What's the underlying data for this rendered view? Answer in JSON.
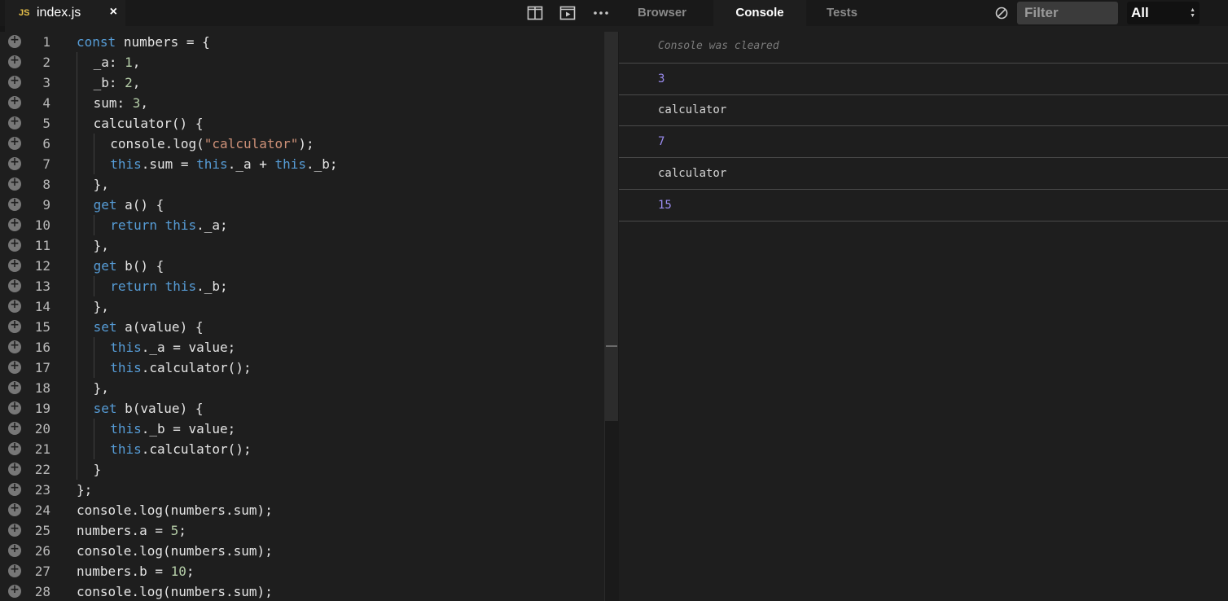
{
  "file_tab": {
    "badge": "JS",
    "name": "index.js",
    "close": "×"
  },
  "panel_tabs": [
    "Browser",
    "Console",
    "Tests"
  ],
  "active_panel": "Console",
  "console_toolbar": {
    "filter_placeholder": "Filter",
    "level": "All"
  },
  "toolbar_icons": [
    "split-editor-icon",
    "preview-icon",
    "more-icon",
    "clear-console-icon"
  ],
  "code_lines": [
    {
      "n": "1",
      "indent": 0,
      "tokens": [
        [
          "kw",
          "const"
        ],
        [
          "",
          "numbers = {"
        ]
      ]
    },
    {
      "n": "2",
      "indent": 1,
      "tokens": [
        [
          "",
          "_a: "
        ],
        [
          "num",
          "1"
        ],
        [
          "",
          ","
        ]
      ]
    },
    {
      "n": "3",
      "indent": 1,
      "tokens": [
        [
          "",
          "_b: "
        ],
        [
          "num",
          "2"
        ],
        [
          "",
          ","
        ]
      ]
    },
    {
      "n": "4",
      "indent": 1,
      "tokens": [
        [
          "",
          "sum: "
        ],
        [
          "num",
          "3"
        ],
        [
          "",
          ","
        ]
      ]
    },
    {
      "n": "5",
      "indent": 1,
      "tokens": [
        [
          "",
          "calculator() {"
        ]
      ]
    },
    {
      "n": "6",
      "indent": 2,
      "tokens": [
        [
          "",
          "console.log("
        ],
        [
          "str",
          "\"calculator\""
        ],
        [
          "",
          ");"
        ]
      ]
    },
    {
      "n": "7",
      "indent": 2,
      "tokens": [
        [
          "kw",
          "this"
        ],
        [
          "",
          ".sum = "
        ],
        [
          "kw",
          "this"
        ],
        [
          "",
          "._a + "
        ],
        [
          "kw",
          "this"
        ],
        [
          "",
          "._b;"
        ]
      ]
    },
    {
      "n": "8",
      "indent": 1,
      "tokens": [
        [
          "",
          "},"
        ]
      ]
    },
    {
      "n": "9",
      "indent": 1,
      "tokens": [
        [
          "kw",
          "get"
        ],
        [
          "",
          " a() {"
        ]
      ]
    },
    {
      "n": "10",
      "indent": 2,
      "tokens": [
        [
          "kw",
          "return"
        ],
        [
          "",
          " "
        ],
        [
          "kw",
          "this"
        ],
        [
          "",
          "._a;"
        ]
      ]
    },
    {
      "n": "11",
      "indent": 1,
      "tokens": [
        [
          "",
          "},"
        ]
      ]
    },
    {
      "n": "12",
      "indent": 1,
      "tokens": [
        [
          "kw",
          "get"
        ],
        [
          "",
          " b() {"
        ]
      ]
    },
    {
      "n": "13",
      "indent": 2,
      "tokens": [
        [
          "kw",
          "return"
        ],
        [
          "",
          " "
        ],
        [
          "kw",
          "this"
        ],
        [
          "",
          "._b;"
        ]
      ]
    },
    {
      "n": "14",
      "indent": 1,
      "tokens": [
        [
          "",
          "},"
        ]
      ]
    },
    {
      "n": "15",
      "indent": 1,
      "tokens": [
        [
          "kw",
          "set"
        ],
        [
          "",
          " a(value) {"
        ]
      ]
    },
    {
      "n": "16",
      "indent": 2,
      "tokens": [
        [
          "kw",
          "this"
        ],
        [
          "",
          "._a = value;"
        ]
      ]
    },
    {
      "n": "17",
      "indent": 2,
      "tokens": [
        [
          "kw",
          "this"
        ],
        [
          "",
          ".calculator();"
        ]
      ]
    },
    {
      "n": "18",
      "indent": 1,
      "tokens": [
        [
          "",
          "},"
        ]
      ]
    },
    {
      "n": "19",
      "indent": 1,
      "tokens": [
        [
          "kw",
          "set"
        ],
        [
          "",
          " b(value) {"
        ]
      ]
    },
    {
      "n": "20",
      "indent": 2,
      "tokens": [
        [
          "kw",
          "this"
        ],
        [
          "",
          "._b = value;"
        ]
      ]
    },
    {
      "n": "21",
      "indent": 2,
      "tokens": [
        [
          "kw",
          "this"
        ],
        [
          "",
          ".calculator();"
        ]
      ]
    },
    {
      "n": "22",
      "indent": 1,
      "tokens": [
        [
          "",
          "}"
        ]
      ]
    },
    {
      "n": "23",
      "indent": 0,
      "tokens": [
        [
          "",
          "};"
        ]
      ]
    },
    {
      "n": "24",
      "indent": 0,
      "tokens": [
        [
          "",
          "console.log(numbers.sum);"
        ]
      ]
    },
    {
      "n": "25",
      "indent": 0,
      "tokens": [
        [
          "",
          "numbers.a = "
        ],
        [
          "num",
          "5"
        ],
        [
          "",
          ";"
        ]
      ]
    },
    {
      "n": "26",
      "indent": 0,
      "tokens": [
        [
          "",
          "console.log(numbers.sum);"
        ]
      ]
    },
    {
      "n": "27",
      "indent": 0,
      "tokens": [
        [
          "",
          "numbers.b = "
        ],
        [
          "num",
          "10"
        ],
        [
          "",
          ";"
        ]
      ]
    },
    {
      "n": "28",
      "indent": 0,
      "tokens": [
        [
          "",
          "console.log(numbers.sum);"
        ]
      ]
    }
  ],
  "console": {
    "cleared_message": "Console was cleared",
    "entries": [
      {
        "text": "3",
        "kind": "number"
      },
      {
        "text": "calculator",
        "kind": "string"
      },
      {
        "text": "7",
        "kind": "number"
      },
      {
        "text": "calculator",
        "kind": "string"
      },
      {
        "text": "15",
        "kind": "number"
      }
    ]
  },
  "colors": {
    "keyword": "#569cd6",
    "number": "#b5cea8",
    "string": "#ce9178",
    "console_number": "#9b8cf0",
    "js_badge": "#e8c14a"
  }
}
